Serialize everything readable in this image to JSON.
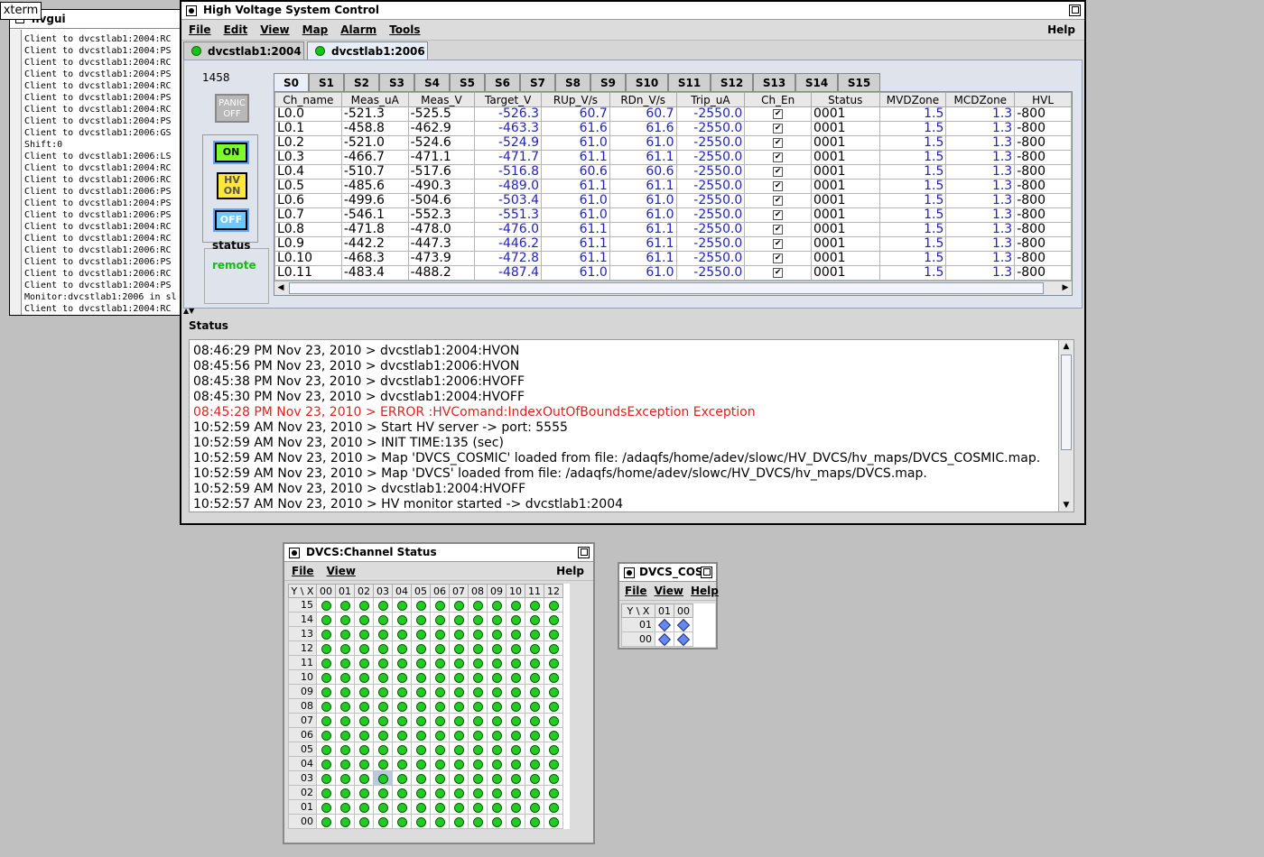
{
  "xterm": {
    "label": "xterm",
    "title": "hvgui",
    "lines": [
      "Client to dvcstlab1:2004:RC",
      "Client to dvcstlab1:2004:PS",
      "Client to dvcstlab1:2004:RC",
      "Client to dvcstlab1:2004:PS",
      "Client to dvcstlab1:2004:RC",
      "Client to dvcstlab1:2004:PS",
      "Client to dvcstlab1:2004:RC",
      "Client to dvcstlab1:2004:PS",
      "Client to dvcstlab1:2006:GS",
      "Shift:0",
      "Client to dvcstlab1:2006:LS",
      "Client to dvcstlab1:2004:RC",
      "Client to dvcstlab1:2006:RC",
      "Client to dvcstlab1:2006:PS",
      "Client to dvcstlab1:2004:PS",
      "Client to dvcstlab1:2006:PS",
      "Client to dvcstlab1:2004:RC",
      "Client to dvcstlab1:2004:RC",
      "Client to dvcstlab1:2006:RC",
      "Client to dvcstlab1:2006:PS",
      "Client to dvcstlab1:2006:RC",
      "Client to dvcstlab1:2004:PS",
      "Monitor:dvcstlab1:2006 in sl",
      "Client to dvcstlab1:2004:RC"
    ]
  },
  "main": {
    "title": "High Voltage System Control",
    "menu": [
      "File",
      "Edit",
      "View",
      "Map",
      "Alarm",
      "Tools"
    ],
    "help": "Help",
    "host_tabs": [
      "dvcstlab1:2004",
      "dvcstlab1:2006"
    ],
    "active_host_tab": 1,
    "crate_number": "1458",
    "panic_label": "PANIC OFF",
    "on_label": "ON",
    "hvon_label": "HV ON",
    "off_label": "OFF",
    "status_label": "status",
    "status_value": "remote",
    "sector_tabs": [
      "S0",
      "S1",
      "S2",
      "S3",
      "S4",
      "S5",
      "S6",
      "S7",
      "S8",
      "S9",
      "S10",
      "S11",
      "S12",
      "S13",
      "S14",
      "S15"
    ],
    "active_sector": 0,
    "columns": [
      "Ch_name",
      "Meas_uA",
      "Meas_V",
      "Target_V",
      "RUp_V/s",
      "RDn_V/s",
      "Trip_uA",
      "Ch_En",
      "Status",
      "MVDZone",
      "MCDZone",
      "HVL"
    ],
    "rows": [
      [
        "L0.0",
        "-521.3",
        "-525.5",
        "-526.3",
        "60.7",
        "60.7",
        "-2550.0",
        "✔",
        "0001",
        "1.5",
        "1.3",
        "-800"
      ],
      [
        "L0.1",
        "-458.8",
        "-462.9",
        "-463.3",
        "61.6",
        "61.6",
        "-2550.0",
        "✔",
        "0001",
        "1.5",
        "1.3",
        "-800"
      ],
      [
        "L0.2",
        "-521.0",
        "-524.6",
        "-524.9",
        "61.0",
        "61.0",
        "-2550.0",
        "✔",
        "0001",
        "1.5",
        "1.3",
        "-800"
      ],
      [
        "L0.3",
        "-466.7",
        "-471.1",
        "-471.7",
        "61.1",
        "61.1",
        "-2550.0",
        "✔",
        "0001",
        "1.5",
        "1.3",
        "-800"
      ],
      [
        "L0.4",
        "-510.7",
        "-517.6",
        "-516.8",
        "60.6",
        "60.6",
        "-2550.0",
        "✔",
        "0001",
        "1.5",
        "1.3",
        "-800"
      ],
      [
        "L0.5",
        "-485.6",
        "-490.3",
        "-489.0",
        "61.1",
        "61.1",
        "-2550.0",
        "✔",
        "0001",
        "1.5",
        "1.3",
        "-800"
      ],
      [
        "L0.6",
        "-499.6",
        "-504.6",
        "-503.4",
        "61.0",
        "61.0",
        "-2550.0",
        "✔",
        "0001",
        "1.5",
        "1.3",
        "-800"
      ],
      [
        "L0.7",
        "-546.1",
        "-552.3",
        "-551.3",
        "61.0",
        "61.0",
        "-2550.0",
        "✔",
        "0001",
        "1.5",
        "1.3",
        "-800"
      ],
      [
        "L0.8",
        "-471.8",
        "-478.0",
        "-476.0",
        "61.1",
        "61.1",
        "-2550.0",
        "✔",
        "0001",
        "1.5",
        "1.3",
        "-800"
      ],
      [
        "L0.9",
        "-442.2",
        "-447.3",
        "-446.2",
        "61.1",
        "61.1",
        "-2550.0",
        "✔",
        "0001",
        "1.5",
        "1.3",
        "-800"
      ],
      [
        "L0.10",
        "-468.3",
        "-473.9",
        "-472.8",
        "61.1",
        "61.1",
        "-2550.0",
        "✔",
        "0001",
        "1.5",
        "1.3",
        "-800"
      ],
      [
        "L0.11",
        "-483.4",
        "-488.2",
        "-487.4",
        "61.0",
        "61.0",
        "-2550.0",
        "✔",
        "0001",
        "1.5",
        "1.3",
        "-800"
      ]
    ],
    "status_title": "Status",
    "status_log": [
      {
        "text": "08:46:29 PM Nov 23, 2010 > dvcstlab1:2004:HVON",
        "error": false
      },
      {
        "text": "08:45:56 PM Nov 23, 2010 > dvcstlab1:2006:HVON",
        "error": false
      },
      {
        "text": "08:45:38 PM Nov 23, 2010 > dvcstlab1:2006:HVOFF",
        "error": false
      },
      {
        "text": "08:45:30 PM Nov 23, 2010 > dvcstlab1:2004:HVOFF",
        "error": false
      },
      {
        "text": "08:45:28 PM Nov 23, 2010 > ERROR :HVComand:IndexOutOfBoundsException Exception",
        "error": true
      },
      {
        "text": "10:52:59 AM Nov 23, 2010 > Start HV server -> port: 5555",
        "error": false
      },
      {
        "text": "10:52:59 AM Nov 23, 2010 > INIT TIME:135 (sec)",
        "error": false
      },
      {
        "text": "10:52:59 AM Nov 23, 2010 > Map 'DVCS_COSMIC' loaded from file: /adaqfs/home/adev/slowc/HV_DVCS/hv_maps/DVCS_COSMIC.map.",
        "error": false
      },
      {
        "text": "10:52:59 AM Nov 23, 2010 > Map 'DVCS' loaded from file: /adaqfs/home/adev/slowc/HV_DVCS/hv_maps/DVCS.map.",
        "error": false
      },
      {
        "text": "10:52:59 AM Nov 23, 2010 > dvcstlab1:2004:HVOFF",
        "error": false
      },
      {
        "text": "10:52:57 AM Nov 23, 2010 > HV monitor started -> dvcstlab1:2004",
        "error": false
      }
    ],
    "error_color": "#e02020",
    "value_color": "#2222bb"
  },
  "channel_status": {
    "title": "DVCS:Channel Status",
    "menu": [
      "File",
      "View"
    ],
    "help": "Help",
    "corner": "Y \\ X",
    "x_labels": [
      "00",
      "01",
      "02",
      "03",
      "04",
      "05",
      "06",
      "07",
      "08",
      "09",
      "10",
      "11",
      "12"
    ],
    "y_labels": [
      "15",
      "14",
      "13",
      "12",
      "11",
      "10",
      "09",
      "08",
      "07",
      "06",
      "05",
      "04",
      "03",
      "02",
      "01",
      "00"
    ],
    "selected_cell": {
      "y": "03",
      "x": "03"
    },
    "dot_color": "#22cc22"
  },
  "cosmic": {
    "title": "DVCS_COSMIC",
    "title_visible": "DVCS_COS",
    "menu": [
      "File",
      "View",
      "Help"
    ],
    "corner": "Y \\ X",
    "x_labels": [
      "01",
      "00"
    ],
    "y_labels": [
      "01",
      "00"
    ],
    "diamond_color": "#6688ee"
  }
}
